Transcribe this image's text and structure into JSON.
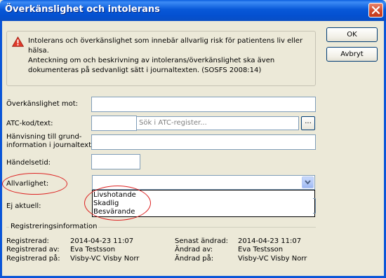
{
  "window": {
    "title": "Överkänslighet och intolerans"
  },
  "warning": {
    "line1": "Intolerans och överkänslighet som innebär allvarlig risk för patientens liv eller hälsa.",
    "line2": "Anteckning om och beskrivning av intolerans/överkänslighet ska även dokumenteras på sedvanligt sätt i journaltexten. (SOSFS 2008:14)"
  },
  "buttons": {
    "ok": "OK",
    "cancel": "Avbryt",
    "browse": "..."
  },
  "form": {
    "oversensitivity_label": "Överkänslighet mot:",
    "atc_label": "ATC-kod/text:",
    "atc_search_placeholder": "Sök i ATC-register...",
    "reference_label_line1": "Hänvisning till grund-",
    "reference_label_line2": "information i journaltext:",
    "event_time_label": "Händelsetid:",
    "severity_label": "Allvarlighet:",
    "severity_options": [
      "Livshotande",
      "Skadlig",
      "Besvärande"
    ],
    "not_current_label": "Ej aktuell:"
  },
  "registration": {
    "group_title": "Registreringsinformation",
    "registered_label": "Registrerad:",
    "registered_value": "2014-04-23 11:07",
    "registered_by_label": "Registrerad av:",
    "registered_by_value": "Eva Testsson",
    "registered_at_label": "Registrerad på:",
    "registered_at_value": "Visby-VC Visby Norr",
    "last_changed_label": "Senast ändrad:",
    "last_changed_value": "2014-04-23 11:07",
    "changed_by_label": "Ändrad av:",
    "changed_by_value": "Eva Testsson",
    "changed_at_label": "Ändrad på:",
    "changed_at_value": "Visby-VC Visby Norr"
  },
  "icons": {
    "warning": "warning-triangle-icon",
    "close": "close-icon",
    "dropdown": "chevron-down-icon"
  },
  "colors": {
    "titlebar": "#0858d8",
    "annotation": "#dd2222",
    "input_border": "#7f9db9"
  }
}
